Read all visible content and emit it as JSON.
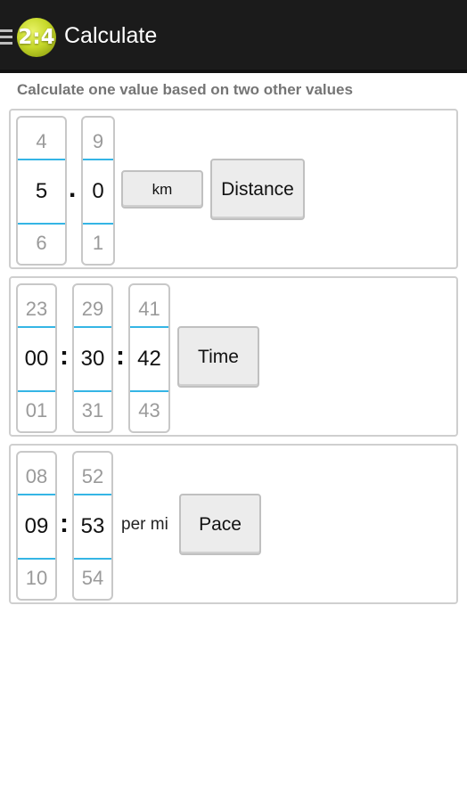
{
  "app": {
    "logo_text": "2:4",
    "title": "Calculate"
  },
  "instruction": "Calculate one value based on two other values",
  "distance": {
    "whole": {
      "prev": "4",
      "value": "5",
      "next": "6"
    },
    "separator": ".",
    "fraction": {
      "prev": "9",
      "value": "0",
      "next": "1"
    },
    "unit_button": "km",
    "action_button": "Distance"
  },
  "time": {
    "hours": {
      "prev": "23",
      "value": "00",
      "next": "01"
    },
    "minutes": {
      "prev": "29",
      "value": "30",
      "next": "31"
    },
    "seconds": {
      "prev": "41",
      "value": "42",
      "next": "43"
    },
    "separator": ":",
    "action_button": "Time"
  },
  "pace": {
    "minutes": {
      "prev": "08",
      "value": "09",
      "next": "10"
    },
    "seconds": {
      "prev": "52",
      "value": "53",
      "next": "54"
    },
    "separator": ":",
    "unit_label": "per mi",
    "action_button": "Pace"
  },
  "colors": {
    "appbar": "#1b1b1b",
    "picker_line": "#35b5e5",
    "logo": "#c7d92a"
  },
  "icons": {
    "menu": "hamburger-menu-icon"
  }
}
